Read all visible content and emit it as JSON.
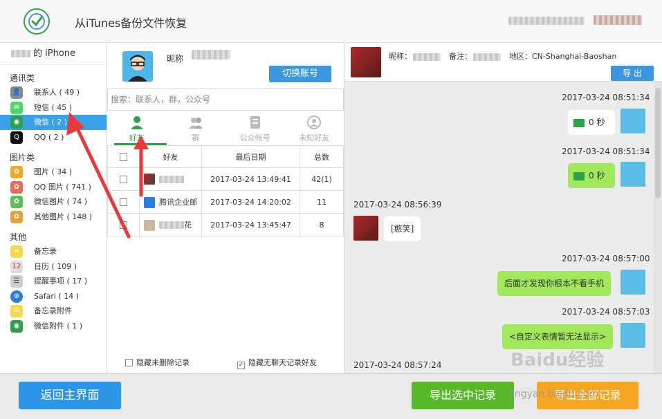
{
  "app": {
    "title": "从iTunes备份文件恢复"
  },
  "sidebar": {
    "device": "的 iPhone",
    "categories": [
      {
        "label": "通讯类",
        "items": [
          {
            "label": "联系人 ( 49 )",
            "icon": "contacts-icon",
            "color": "#8a8a8a"
          },
          {
            "label": "短信 ( 45 )",
            "icon": "message-icon",
            "color": "#4cd964"
          },
          {
            "label": "微信 ( 2 )",
            "icon": "wechat-icon",
            "color": "#2aa24a"
          },
          {
            "label": "QQ ( 2 )",
            "icon": "qq-icon",
            "color": "#111111"
          }
        ]
      },
      {
        "label": "图片类",
        "items": [
          {
            "label": "图片 ( 34 )",
            "icon": "photos-icon",
            "color": "#f5a623"
          },
          {
            "label": "QQ 图片 ( 741 )",
            "icon": "qq-photos-icon",
            "color": "#e86a5a"
          },
          {
            "label": "微信图片 ( 74 )",
            "icon": "wechat-photos-icon",
            "color": "#5ac05a"
          },
          {
            "label": "其他图片 ( 148 )",
            "icon": "other-photos-icon",
            "color": "#e8a03a"
          }
        ]
      },
      {
        "label": "其他",
        "items": [
          {
            "label": "备忘录",
            "icon": "notes-icon",
            "color": "#f6d94a"
          },
          {
            "label": "日历 ( 109 )",
            "icon": "calendar-icon",
            "color": "#dddddd"
          },
          {
            "label": "提醒事项 ( 17 )",
            "icon": "reminders-icon",
            "color": "#cccccc"
          },
          {
            "label": "Safari ( 14 )",
            "icon": "safari-icon",
            "color": "#2b7de0"
          },
          {
            "label": "备忘录附件",
            "icon": "notes-attach-icon",
            "color": "#f6d94a"
          },
          {
            "label": "微信附件 ( 1 )",
            "icon": "wechat-attach-icon",
            "color": "#2aa24a"
          }
        ]
      }
    ]
  },
  "account": {
    "nickname_label": "昵称",
    "switch_label": "切换账号"
  },
  "search": {
    "placeholder": "搜索：联系人，群，公众号"
  },
  "tabs": [
    {
      "label": "好友",
      "icon": "friend-icon"
    },
    {
      "label": "群",
      "icon": "group-icon"
    },
    {
      "label": "公众帐号",
      "icon": "official-account-icon"
    },
    {
      "label": "未知好友",
      "icon": "unknown-friend-icon"
    }
  ],
  "table": {
    "headers": [
      "好友",
      "最后日期",
      "总数"
    ],
    "rows": [
      {
        "name": "",
        "date": "2017-03-24 13:49:41",
        "count": "42(1)"
      },
      {
        "name": "腾讯企业邮",
        "date": "2017-03-24 14:20:02",
        "count": "11"
      },
      {
        "name": "花",
        "date": "2017-03-24 13:45:47",
        "count": "8"
      }
    ]
  },
  "options": {
    "hide_undeleted": "隐藏未删除记录",
    "hide_no_chat": "隐藏无聊天记录好友"
  },
  "chat": {
    "nickname_label": "昵称：",
    "remark_label": "备注：",
    "region": "地区：CN-Shanghai-Baoshan",
    "export_label": "导 出",
    "messages": [
      {
        "time": "2017-03-24 08:51:34",
        "text": "0 秒",
        "side": "right"
      },
      {
        "time": "2017-03-24 08:51:34",
        "text": "0 秒",
        "side": "right"
      },
      {
        "time": "2017-03-24 08:56:39",
        "text": "[憨笑]",
        "side": "left"
      },
      {
        "time": "2017-03-24 08:57:00",
        "text": "后面才发现你根本不看手机",
        "side": "right"
      },
      {
        "time": "2017-03-24 08:57:03",
        "text": "<自定义表情暂无法显示>",
        "side": "right"
      },
      {
        "time": "2017-03-24 08:57:24",
        "text": "",
        "side": "left"
      }
    ]
  },
  "footer": {
    "home_label": "返回主界面",
    "export_selected_label": "导出选中记录",
    "export_all_label": "导出全部记录"
  },
  "watermark": {
    "text": "Baidu经验",
    "sub": "jingyan.baidu.com"
  },
  "colors": {
    "accent_blue": "#2b95e6",
    "wechat_green": "#2aa24a",
    "bubble_green": "#a0e75a",
    "orange": "#f5a623"
  }
}
